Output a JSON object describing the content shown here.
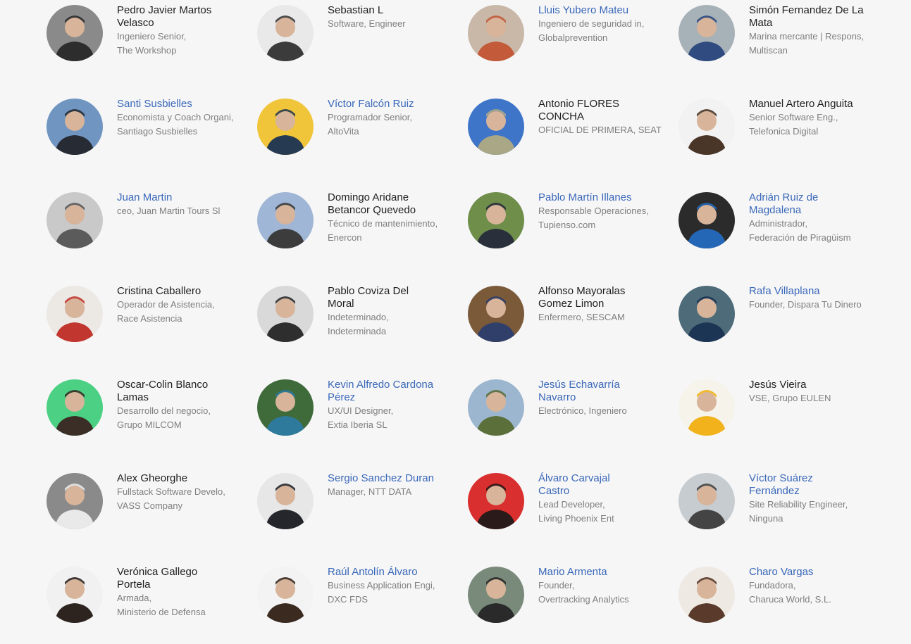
{
  "people": [
    {
      "name": "Pedro Javier Martos Velasco",
      "role": "Ingeniero Senior, The Workshop",
      "linked": false,
      "colors": [
        "#8a8a8a",
        "#2d2d2d"
      ]
    },
    {
      "name": "Sebastian L",
      "role": "Software, Engineer",
      "linked": false,
      "colors": [
        "#e9e9e9",
        "#3b3b3b"
      ]
    },
    {
      "name": "Lluis Yubero Mateu",
      "role": "Ingeniero de seguridad in, Globalprevention",
      "linked": true,
      "colors": [
        "#c9b8a8",
        "#c35a3a"
      ]
    },
    {
      "name": "Simón Fernandez De La Mata",
      "role": "Marina mercante | Respons, Multiscan",
      "linked": false,
      "colors": [
        "#a7b1b8",
        "#2f4b7f"
      ]
    },
    {
      "name": "Santi Susbielles",
      "role": "Economista y Coach Organi, Santiago Susbielles",
      "linked": true,
      "colors": [
        "#6f95c0",
        "#272b33"
      ]
    },
    {
      "name": "Víctor Falcón Ruiz",
      "role": "Programador Senior, AltoVita",
      "linked": true,
      "colors": [
        "#f1c53a",
        "#263a52"
      ]
    },
    {
      "name": "Antonio FLORES CONCHA",
      "role": "OFICIAL DE PRIMERA, SEAT",
      "linked": false,
      "colors": [
        "#3f75c8",
        "#a9a786"
      ]
    },
    {
      "name": "Manuel Artero Anguita",
      "role": "Senior Software Eng., Telefonica Digital",
      "linked": false,
      "colors": [
        "#f2f2f2",
        "#4a3628"
      ]
    },
    {
      "name": "Juan Martin",
      "role": "ceo, Juan Martin Tours Sl",
      "linked": true,
      "colors": [
        "#c9c9c9",
        "#5b5b5b"
      ]
    },
    {
      "name": "Domingo Aridane Betancor Quevedo",
      "role": "Técnico de mantenimiento, Enercon",
      "linked": false,
      "colors": [
        "#9fb6d6",
        "#3c3c3c"
      ]
    },
    {
      "name": "Pablo Martín Illanes",
      "role": "Responsable Operaciones, Tupienso.com",
      "linked": true,
      "colors": [
        "#6f8e4a",
        "#2a2f3c"
      ]
    },
    {
      "name": "Adrián Ruiz de Magdalena",
      "role": "Administrador, Federación de Piragüism",
      "linked": true,
      "colors": [
        "#2b2b2b",
        "#2467b6"
      ]
    },
    {
      "name": "Cristina Caballero",
      "role": "Operador de Asistencia, Race Asistencia",
      "linked": false,
      "colors": [
        "#ece8e4",
        "#c1372f"
      ]
    },
    {
      "name": "Pablo Coviza Del Moral",
      "role": "Indeterminado, Indeterminada",
      "linked": false,
      "colors": [
        "#d9d9d9",
        "#2e2e2e"
      ]
    },
    {
      "name": "Alfonso Mayoralas Gomez Limon",
      "role": "Enfermero, SESCAM",
      "linked": false,
      "colors": [
        "#7b5a3a",
        "#2f3f6a"
      ]
    },
    {
      "name": "Rafa Villaplana",
      "role": "Founder, Dispara Tu Dinero",
      "linked": true,
      "colors": [
        "#4e6b7a",
        "#1d3554"
      ]
    },
    {
      "name": "Oscar-Colin Blanco Lamas",
      "role": "Desarrollo del negocio, Grupo MILCOM",
      "linked": false,
      "colors": [
        "#4cd083",
        "#3a2e26"
      ]
    },
    {
      "name": "Kevin Alfredo Cardona Pérez",
      "role": "UX/UI Designer, Extia Iberia SL",
      "linked": true,
      "colors": [
        "#3f6b3a",
        "#2e7a9c"
      ]
    },
    {
      "name": "Jesús Echavarría Navarro",
      "role": "Electrónico, Ingeniero",
      "linked": true,
      "colors": [
        "#9db6cf",
        "#5b6f3a"
      ]
    },
    {
      "name": "Jesús Vieira",
      "role": "VSE, Grupo EULEN",
      "linked": false,
      "colors": [
        "#f6f3ea",
        "#f1b21c"
      ]
    },
    {
      "name": "Alex Gheorghe",
      "role": "Fullstack Software Develo, VASS Company",
      "linked": false,
      "colors": [
        "#8a8a8a",
        "#e9e9e9"
      ]
    },
    {
      "name": "Sergio Sanchez Duran",
      "role": "Manager, NTT DATA",
      "linked": true,
      "colors": [
        "#e7e7e7",
        "#24262c"
      ]
    },
    {
      "name": "Álvaro Carvajal Castro",
      "role": "Lead Developer, Living Phoenix Ent",
      "linked": true,
      "colors": [
        "#d92f2f",
        "#2a1a1a"
      ]
    },
    {
      "name": "Víctor Suárez Fernández",
      "role": "Site Reliability Engineer, Ninguna",
      "linked": true,
      "colors": [
        "#c7ccd0",
        "#444"
      ]
    },
    {
      "name": "Verónica Gallego Portela",
      "role": "Armada, Ministerio de Defensa",
      "linked": false,
      "colors": [
        "#f1f1f1",
        "#2d2420"
      ]
    },
    {
      "name": "Raúl Antolín Álvaro",
      "role": "Business Application Engi, DXC FDS",
      "linked": true,
      "colors": [
        "#f3f3f3",
        "#3a2a20"
      ]
    },
    {
      "name": "Mario Armenta",
      "role": "Founder, Overtracking Analytics",
      "linked": true,
      "colors": [
        "#7a8a7a",
        "#2a2a2a"
      ]
    },
    {
      "name": "Charo Vargas",
      "role": "Fundadora, Charuca World, S.L.",
      "linked": true,
      "colors": [
        "#efe9e3",
        "#5a3a2a"
      ]
    }
  ]
}
